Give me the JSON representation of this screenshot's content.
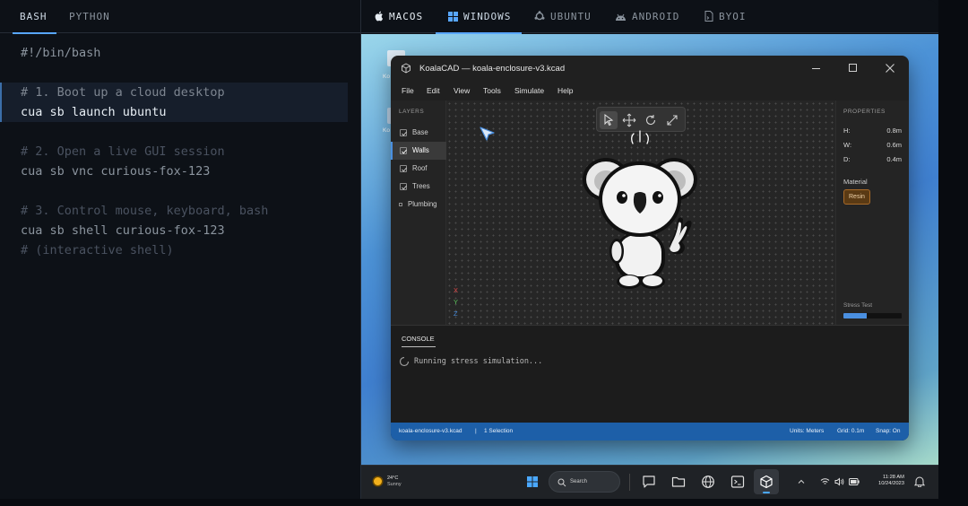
{
  "left_tabs": [
    {
      "label": "BASH",
      "active": true
    },
    {
      "label": "PYTHON",
      "active": false
    }
  ],
  "code": {
    "shebang": "#!/bin/bash",
    "step1_comment": "# 1. Boot up a cloud desktop",
    "step1_command": "cua sb launch ubuntu",
    "step2_comment": "# 2. Open a live GUI session",
    "step2_command": "cua sb vnc curious-fox-123",
    "step3_comment": "# 3. Control mouse, keyboard, bash",
    "step3_command": "cua sb shell curious-fox-123",
    "step3_note": "# (interactive shell)"
  },
  "os_tabs": [
    {
      "label": "MACOS",
      "icon": "apple-icon",
      "active": false
    },
    {
      "label": "WINDOWS",
      "icon": "windows-icon",
      "active": true
    },
    {
      "label": "UBUNTU",
      "icon": "ubuntu-icon",
      "active": false
    },
    {
      "label": "ANDROID",
      "icon": "android-icon",
      "active": false
    },
    {
      "label": "BYOI",
      "icon": "file-icon",
      "active": false
    }
  ],
  "desktop_icons": [
    "Ko",
    "Ko"
  ],
  "app": {
    "title": "KoalaCAD — koala-enclosure-v3.kcad",
    "menu": [
      "File",
      "Edit",
      "View",
      "Tools",
      "Simulate",
      "Help"
    ],
    "layers_heading": "LAYERS",
    "layers": [
      {
        "label": "Base",
        "checked": true,
        "selected": false
      },
      {
        "label": "Walls",
        "checked": true,
        "selected": true
      },
      {
        "label": "Roof",
        "checked": true,
        "selected": false
      },
      {
        "label": "Trees",
        "checked": true,
        "selected": false
      },
      {
        "label": "Plumbing",
        "checked": false,
        "selected": false
      }
    ],
    "axes": [
      "X",
      "Y",
      "Z"
    ],
    "properties": {
      "heading": "PROPERTIES",
      "rows": [
        {
          "key": "H:",
          "value": "0.8m"
        },
        {
          "key": "W:",
          "value": "0.6m"
        },
        {
          "key": "D:",
          "value": "0.4m"
        }
      ],
      "material_label": "Material",
      "material_value": "Resin",
      "stress_label": "Stress Test",
      "stress_progress": 0.4
    },
    "console_tab": "CONSOLE",
    "console_message": "Running stress simulation...",
    "status": {
      "file": "koala-enclosure-v3.kcad",
      "separator": "|",
      "selection": "1 Selection",
      "units": "Units: Meters",
      "grid": "Grid: 0.1m",
      "snap": "Snap: On"
    }
  },
  "taskbar": {
    "weather_temp": "24°C",
    "weather_desc": "Sunny",
    "search_label": "Search",
    "time": "11:28 AM",
    "date": "10/24/2023"
  },
  "colors": {
    "accent_blue": "#58a6ff",
    "status_bar": "#1d5fa8",
    "material_badge": "#5a3a14",
    "axis_x": "#e04848",
    "axis_y": "#5cc45c",
    "axis_z": "#4a8fe0"
  }
}
